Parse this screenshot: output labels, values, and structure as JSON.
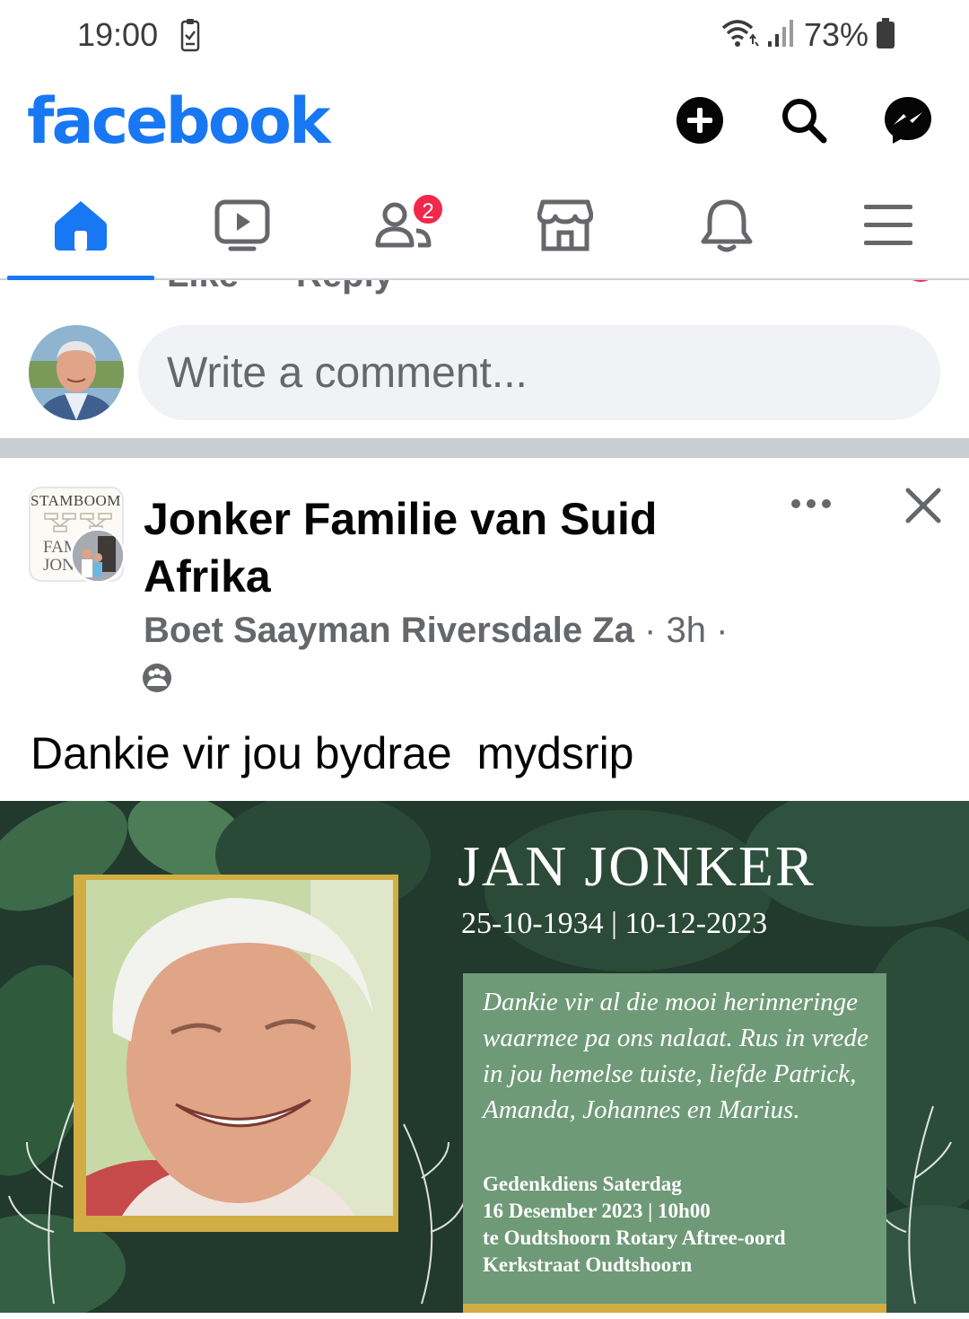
{
  "status_bar": {
    "time": "19:00",
    "battery": "73%"
  },
  "header": {
    "logo": "facebook",
    "icons": [
      "plus-circle-icon",
      "search-icon",
      "messenger-icon"
    ]
  },
  "nav": {
    "items": [
      "home",
      "watch",
      "friends",
      "marketplace",
      "notifications",
      "menu"
    ],
    "active": "home",
    "friends_badge": "2"
  },
  "comment_actions": {
    "like": "Like",
    "reply": "Reply"
  },
  "composer": {
    "placeholder": "Write a comment..."
  },
  "post": {
    "group_name": "Jonker Familie van Suid Afrika",
    "group_avatar_title": "STAMBOOM",
    "group_avatar_sub_1": "FAM",
    "group_avatar_sub_2": "JON",
    "author": "Boet Saayman Riversdale Za",
    "time": "3h",
    "separator": "·",
    "text": "Dankie vir jou bydrae  mydsrip",
    "image": {
      "name": "JAN JONKER",
      "dates": "25-10-1934 | 10-12-2023",
      "message": "Dankie vir al die mooi herinneringe waarmee pa ons nalaat. Rus in vrede in jou hemelse tuiste, liefde Patrick, Amanda, Johannes en Marius.",
      "service_line_1": "Gedenkdiens Saterdag",
      "service_line_2": "16 Desember 2023 | 10h00",
      "service_line_3": "te Oudtshoorn Rotary Aftree-oord",
      "service_line_4": "Kerkstraat Oudtshoorn"
    }
  },
  "colors": {
    "brand": "#1877f2",
    "badge": "#f02849",
    "muted": "#65676b",
    "input_bg": "#f0f2f5"
  }
}
